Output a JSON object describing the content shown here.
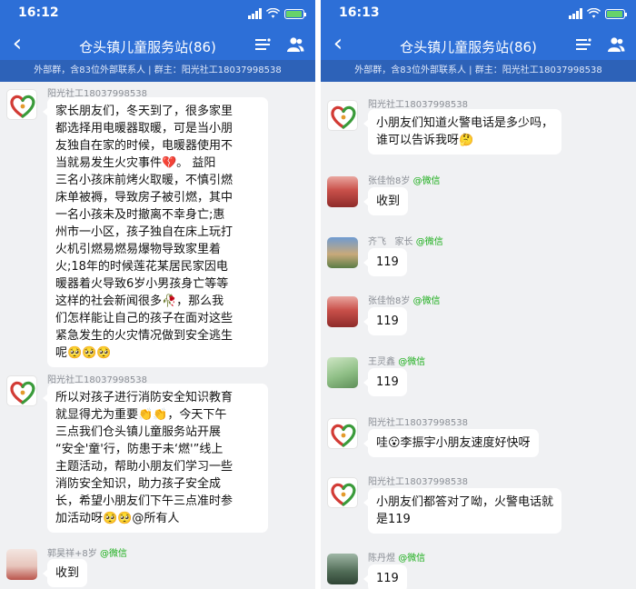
{
  "colors": {
    "accent": "#2d6fd7",
    "sub_bar": "#2d62b8",
    "chat_bg": "#f0f1f3",
    "wechat_green": "#1aad19"
  },
  "left": {
    "status_time": "16:12",
    "chat_title": "仓头镇儿童服务站(86)",
    "sub_info": "外部群，含83位外部联系人 | 群主：阳光社工18037998538",
    "messages": [
      {
        "sender": "阳光社工18037998538",
        "text": "家长朋友们，冬天到了，很多家里\n都选择用电暖器取暖，可是当小朋\n友独自在家的时候，电暖器使用不\n当就易发生火灾事件💔。  益阳\n三名小孩床前烤火取暖，不慎引燃\n床单被褥，导致房子被引燃，其中\n一名小孩未及时撤离不幸身亡;惠\n州市一小区，孩子独自在床上玩打\n火机引燃易燃易爆物导致家里着\n火;18年的时候莲花某居民家因电\n暖器着火导致6岁小男孩身亡等等\n这样的社会新闻很多🥀，那么我\n们怎样能让自己的孩子在面对这些\n紧急发生的火灾情况做到安全逃生\n呢🥺🥺🥺"
      },
      {
        "sender": "阳光社工18037998538",
        "text": "所以对孩子进行消防安全知识教育\n就显得尤为重要👏👏，今天下午\n三点我们仓头镇儿童服务站开展\n“安全'童'行，防患于未‘燃'”线上\n主题活动，帮助小朋友们学习一些\n消防安全知识，助力孩子安全成\n长，希望小朋友们下午三点准时参\n加活动呀🥺🥺@所有人"
      },
      {
        "sender": "郭昊祥+8岁",
        "wechat": "@微信",
        "text": "收到"
      }
    ]
  },
  "right": {
    "status_time": "16:13",
    "chat_title": "仓头镇儿童服务站(86)",
    "sub_info": "外部群，含83位外部联系人 | 群主：阳光社工18037998538",
    "messages": [
      {
        "sender": "阳光社工18037998538",
        "text": "小朋友们知道火警电话是多少吗，\n谁可以告诉我呀🤔"
      },
      {
        "sender": "张佳怡8岁",
        "wechat": "@微信",
        "text": "收到"
      },
      {
        "sender": "齐飞   家长",
        "wechat": "@微信",
        "text": "119"
      },
      {
        "sender": "张佳怡8岁",
        "wechat": "@微信",
        "text": "119"
      },
      {
        "sender": "王灵鑫",
        "wechat": "@微信",
        "text": "119"
      },
      {
        "sender": "阳光社工18037998538",
        "text": "哇😮李振宇小朋友速度好快呀"
      },
      {
        "sender": "阳光社工18037998538",
        "text": "小朋友们都答对了呦，火警电话就\n是119"
      },
      {
        "sender": "陈丹煜",
        "wechat": "@微信",
        "text": "119"
      }
    ]
  }
}
